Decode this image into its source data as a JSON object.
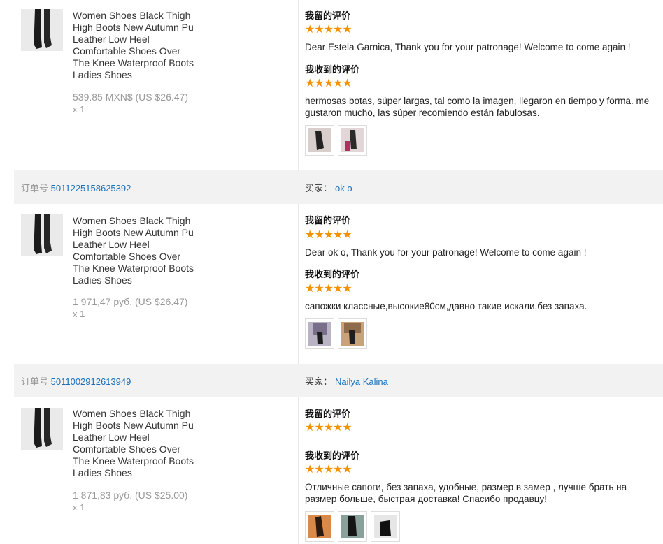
{
  "labels": {
    "my_review": "我留的评价",
    "received_review": "我收到的评价",
    "order_prefix": "订单号",
    "buyer_prefix": "买家："
  },
  "colors": {
    "star": "#f39200",
    "link": "#1a6fba",
    "band": "#f2f2f2"
  },
  "product_title": "Women Shoes Black Thigh High Boots New Autumn Pu Leather Low Heel Comfortable Shoes Over The Knee Waterproof Boots Ladies Shoes",
  "orders": [
    {
      "price": "539.85 MXN$ (US $26.47)",
      "qty": "x 1",
      "my_rating": 5,
      "my_stars": "★★★★★",
      "my_review": "Dear Estela Garnica, Thank you for your patronage! Welcome to come again !",
      "received_rating": 5,
      "received_stars": "★★★★★",
      "received_review": "hermosas botas, súper largas, tal como la imagen, llegaron en tiempo y forma. me gustaron mucho, las súper recomiendo están fabulosas."
    },
    {
      "order_number": "5011225158625392",
      "buyer": "ok o",
      "price": "1 971,47 руб. (US $26.47)",
      "qty": "x 1",
      "my_rating": 5,
      "my_stars": "★★★★★",
      "my_review": "Dear ok o, Thank you for your patronage! Welcome to come again !",
      "received_rating": 5,
      "received_stars": "★★★★★",
      "received_review": "сапожки классные,высокие80см,давно такие искали,без запаха."
    },
    {
      "order_number": "5011002912613949",
      "buyer": "Nailya Kalina",
      "price": "1 871,83 руб. (US $25.00)",
      "qty": "x 1",
      "my_rating": 5,
      "my_stars": "★★★★★",
      "received_rating": 5,
      "received_stars": "★★★★★",
      "received_review": "Отличные сапоги, без запаха, удобные, размер в замер , лучше брать на размер больше, быстрая доставка! Спасибо продавцу!"
    }
  ]
}
